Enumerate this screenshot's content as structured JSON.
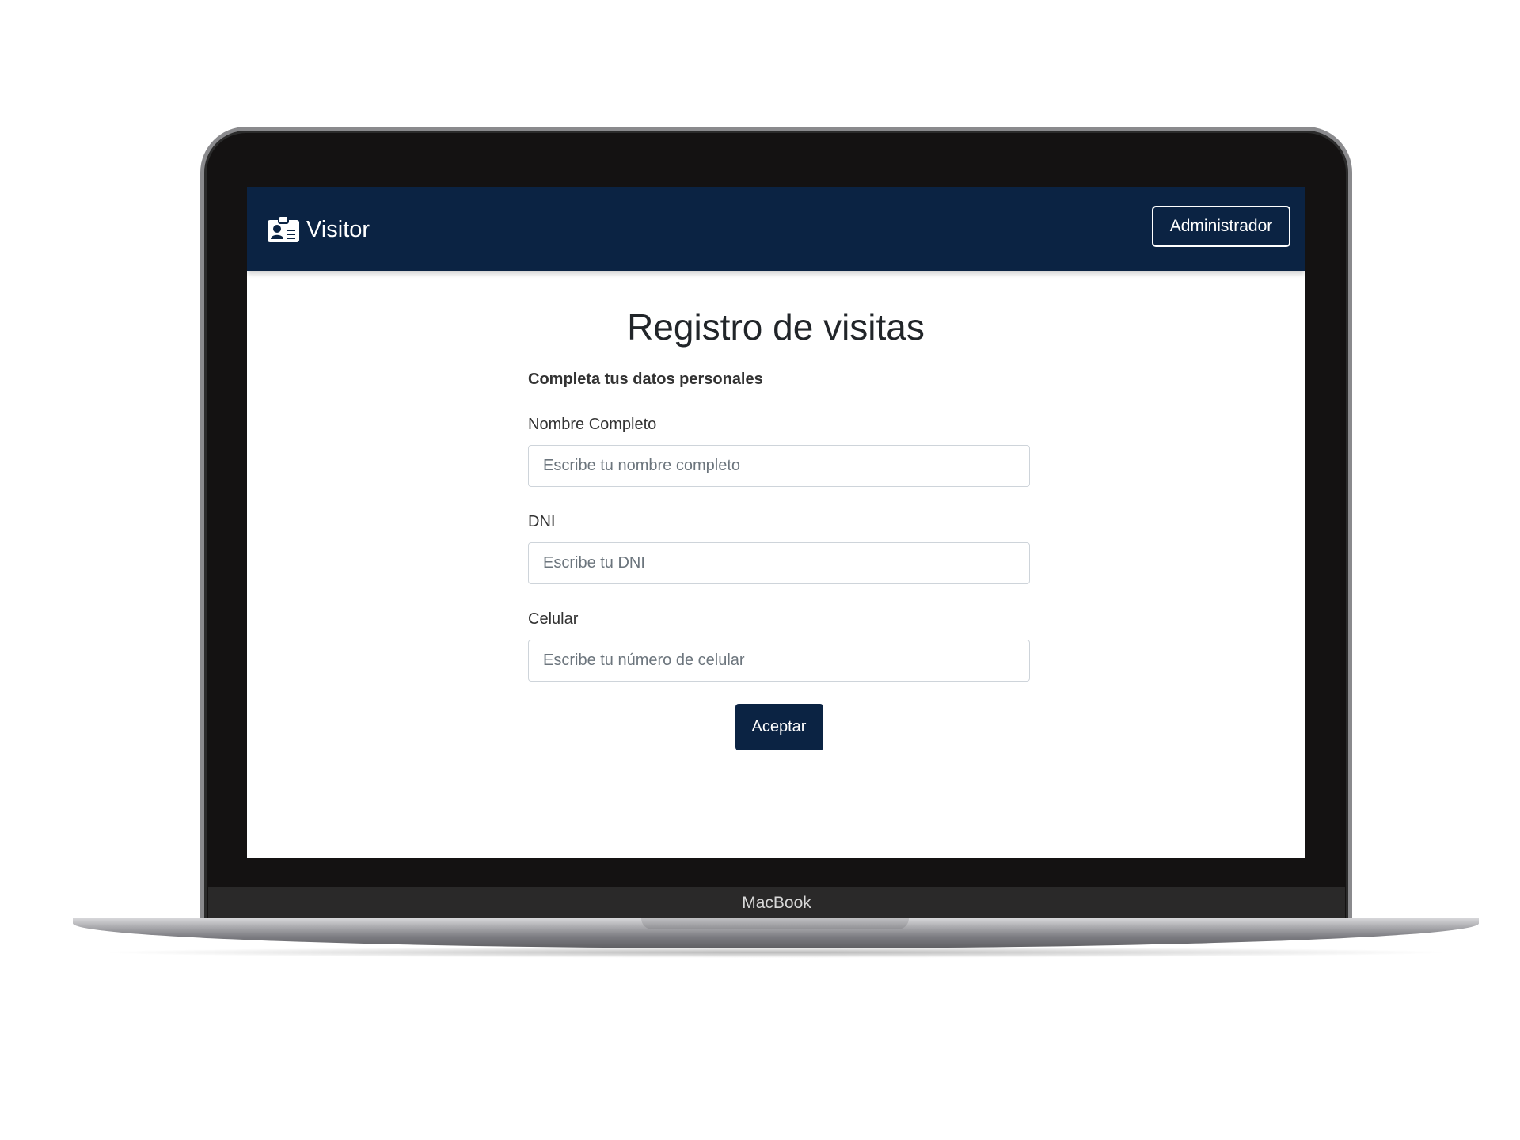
{
  "app": {
    "brand_name": "Visitor",
    "brand_icon": "id-badge-icon",
    "admin_button_label": "Administrador",
    "colors": {
      "primary": "#0b2343",
      "background": "#ffffff"
    }
  },
  "page": {
    "title": "Registro de visitas",
    "subtitle": "Completa tus datos personales"
  },
  "form": {
    "fields": [
      {
        "label": "Nombre Completo",
        "value": "",
        "placeholder": "Escribe tu nombre completo"
      },
      {
        "label": "DNI",
        "value": "",
        "placeholder": "Escribe tu DNI"
      },
      {
        "label": "Celular",
        "value": "",
        "placeholder": "Escribe tu número de celular"
      }
    ],
    "submit_label": "Aceptar"
  },
  "device": {
    "label": "MacBook"
  }
}
